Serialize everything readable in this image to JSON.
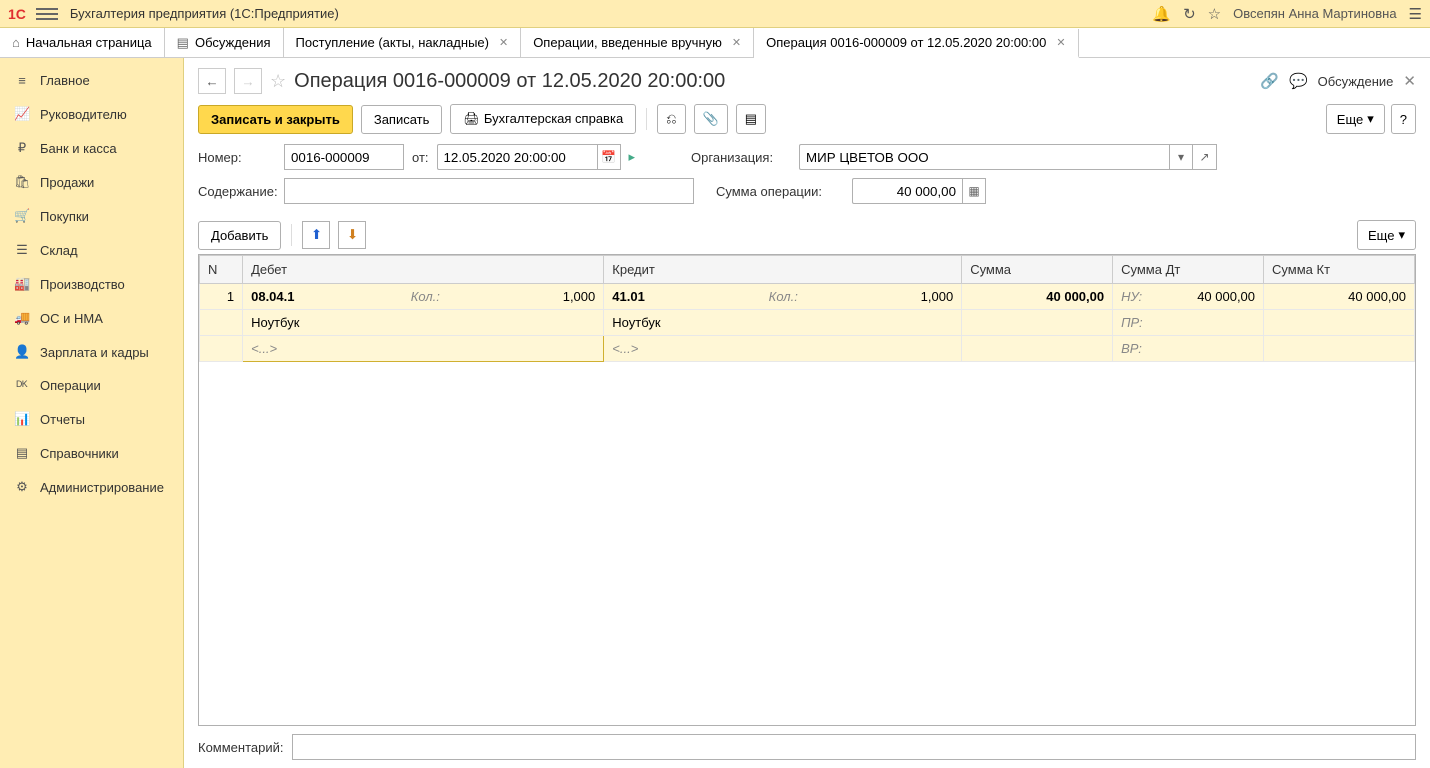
{
  "app": {
    "logo": "1C",
    "title": "Бухгалтерия предприятия  (1С:Предприятие)",
    "user": "Овсепян Анна Мартиновна"
  },
  "tabs": {
    "home": "Начальная страница",
    "discuss": "Обсуждения",
    "t1": "Поступление (акты, накладные)",
    "t2": "Операции, введенные вручную",
    "t3": "Операция 0016-000009 от 12.05.2020 20:00:00"
  },
  "nav": {
    "main": "Главное",
    "lead": "Руководителю",
    "bank": "Банк и касса",
    "sales": "Продажи",
    "purch": "Покупки",
    "stock": "Склад",
    "prod": "Производство",
    "os": "ОС и НМА",
    "salary": "Зарплата и кадры",
    "ops": "Операции",
    "reports": "Отчеты",
    "refs": "Справочники",
    "admin": "Администрирование"
  },
  "page": {
    "title": "Операция 0016-000009 от 12.05.2020 20:00:00",
    "discuss": "Обсуждение"
  },
  "toolbar": {
    "save_close": "Записать и закрыть",
    "save": "Записать",
    "print": "Бухгалтерская справка",
    "more": "Еще",
    "help": "?"
  },
  "form": {
    "num_lbl": "Номер:",
    "num_val": "0016-000009",
    "from_lbl": "от:",
    "date_val": "12.05.2020 20:00:00",
    "org_lbl": "Организация:",
    "org_val": "МИР ЦВЕТОВ ООО",
    "content_lbl": "Содержание:",
    "content_val": "",
    "sum_lbl": "Сумма операции:",
    "sum_val": "40 000,00"
  },
  "gridtool": {
    "add": "Добавить",
    "more": "Еще"
  },
  "grid": {
    "h_n": "N",
    "h_debit": "Дебет",
    "h_credit": "Кредит",
    "h_sum": "Сумма",
    "h_sumdt": "Сумма Дт",
    "h_sumkt": "Сумма Кт",
    "row": {
      "n": "1",
      "d_acct": "08.04.1",
      "d_kol_lbl": "Кол.:",
      "d_kol": "1,000",
      "d_sub1": "Ноутбук",
      "d_sub2": "<...>",
      "c_acct": "41.01",
      "c_kol_lbl": "Кол.:",
      "c_kol": "1,000",
      "c_sub1": "Ноутбук",
      "c_sub2": "<...>",
      "sum": "40 000,00",
      "nu_lbl": "НУ:",
      "nu_dt": "40 000,00",
      "nu_kt": "40 000,00",
      "pr_lbl": "ПР:",
      "vr_lbl": "ВР:"
    }
  },
  "comment": {
    "lbl": "Комментарий:",
    "val": ""
  }
}
